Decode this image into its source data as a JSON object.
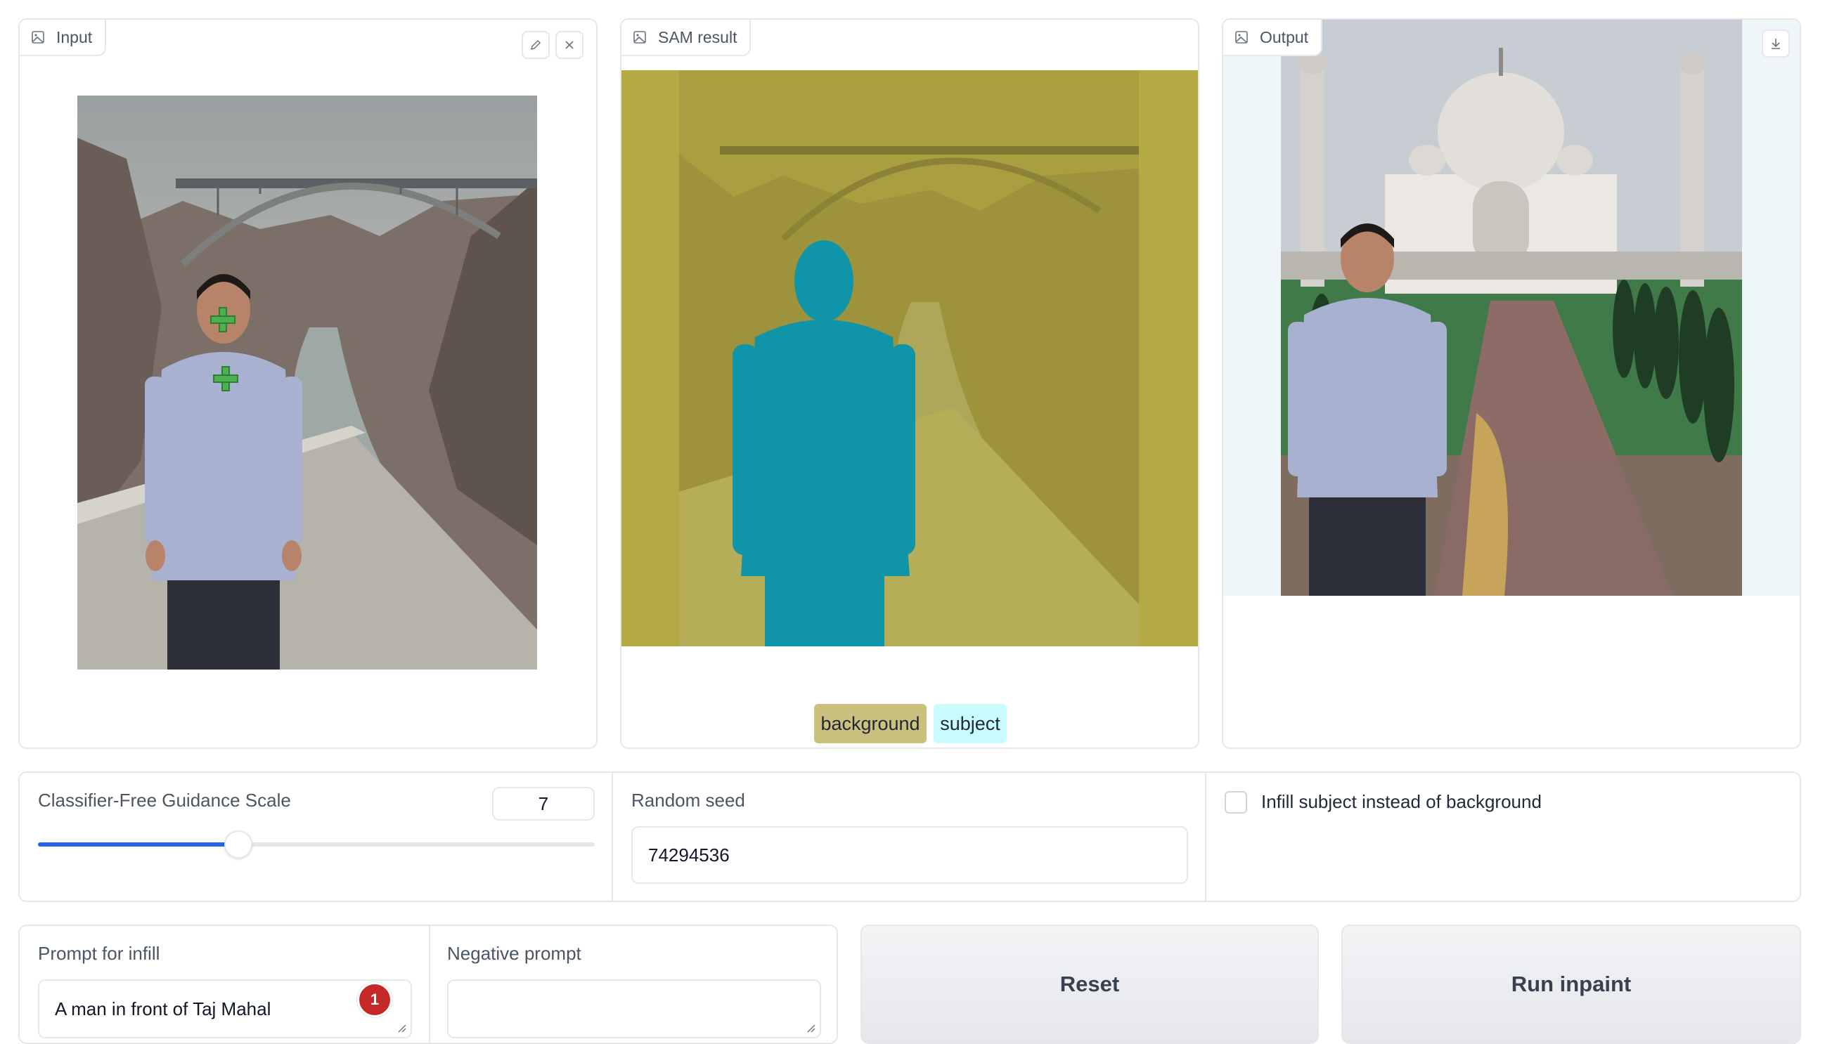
{
  "panels": {
    "input": {
      "label": "Input"
    },
    "sam": {
      "label": "SAM result"
    },
    "output": {
      "label": "Output"
    }
  },
  "legend": [
    {
      "label": "background",
      "color": "#cbc17f"
    },
    {
      "label": "subject",
      "color": "#c9fbfd"
    }
  ],
  "guidance": {
    "label": "Classifier-Free Guidance Scale",
    "value": "7",
    "fraction": 0.36
  },
  "seed": {
    "label": "Random seed",
    "value": "74294536"
  },
  "infill_checkbox": {
    "label": "Infill subject instead of background",
    "checked": false
  },
  "prompt": {
    "label": "Prompt for infill",
    "value": "A man in front of  Taj Mahal",
    "badge": "1"
  },
  "negative_prompt": {
    "label": "Negative prompt",
    "value": ""
  },
  "buttons": {
    "reset": "Reset",
    "run": "Run inpaint"
  },
  "colors": {
    "accent": "#2563eb",
    "mask_background": "#b4aa44",
    "mask_subject": "#0f94a8",
    "badge": "#c62828"
  }
}
